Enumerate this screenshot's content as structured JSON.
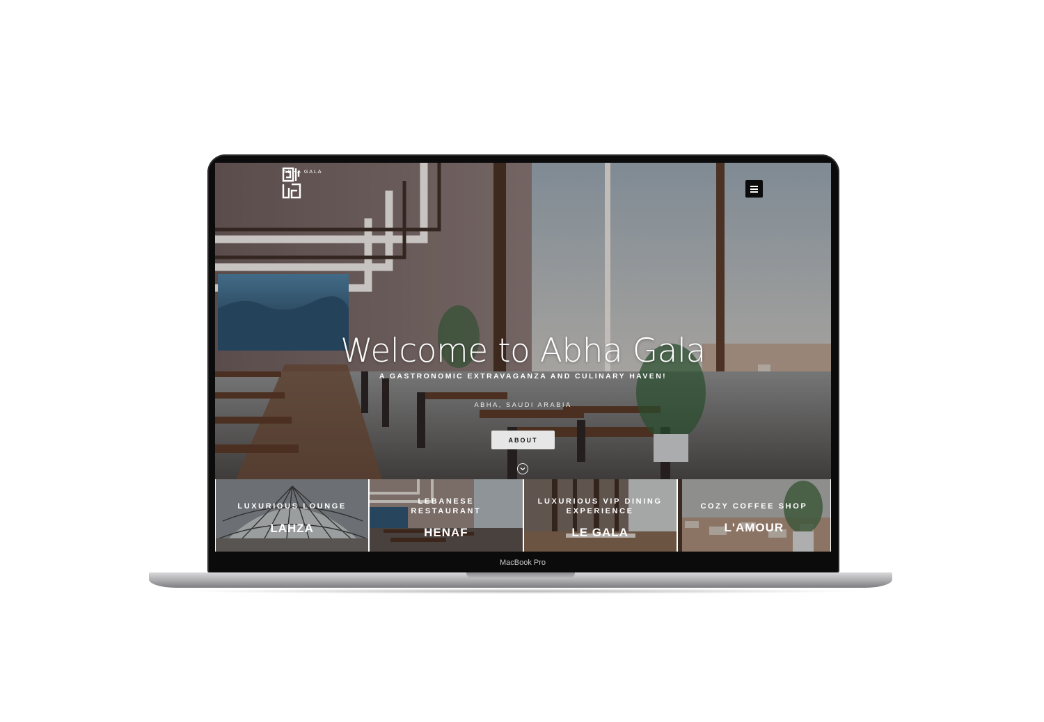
{
  "site": {
    "logo_text": "ABHA GALA",
    "menu_icon": "hamburger-icon"
  },
  "hero": {
    "title": "Welcome to Abha Gala",
    "subtitle": "A GASTRONOMIC EXTRAVAGANZA AND CULINARY HAVEN!",
    "location": "ABHA, SAUDI ARABIA",
    "cta_label": "ABOUT",
    "scroll_icon": "chevron-down-icon"
  },
  "tiles": [
    {
      "caption": "LUXURIOUS LOUNGE",
      "name": "LAHZA"
    },
    {
      "caption": "LEBANESE RESTAURANT",
      "name": "HENAF"
    },
    {
      "caption": "LUXURIOUS VIP DINING EXPERIENCE",
      "name": "LE GALA"
    },
    {
      "caption": "COZY COFFEE SHOP",
      "name": "L'AMOUR"
    }
  ],
  "device": {
    "model_label": "MacBook Pro"
  }
}
